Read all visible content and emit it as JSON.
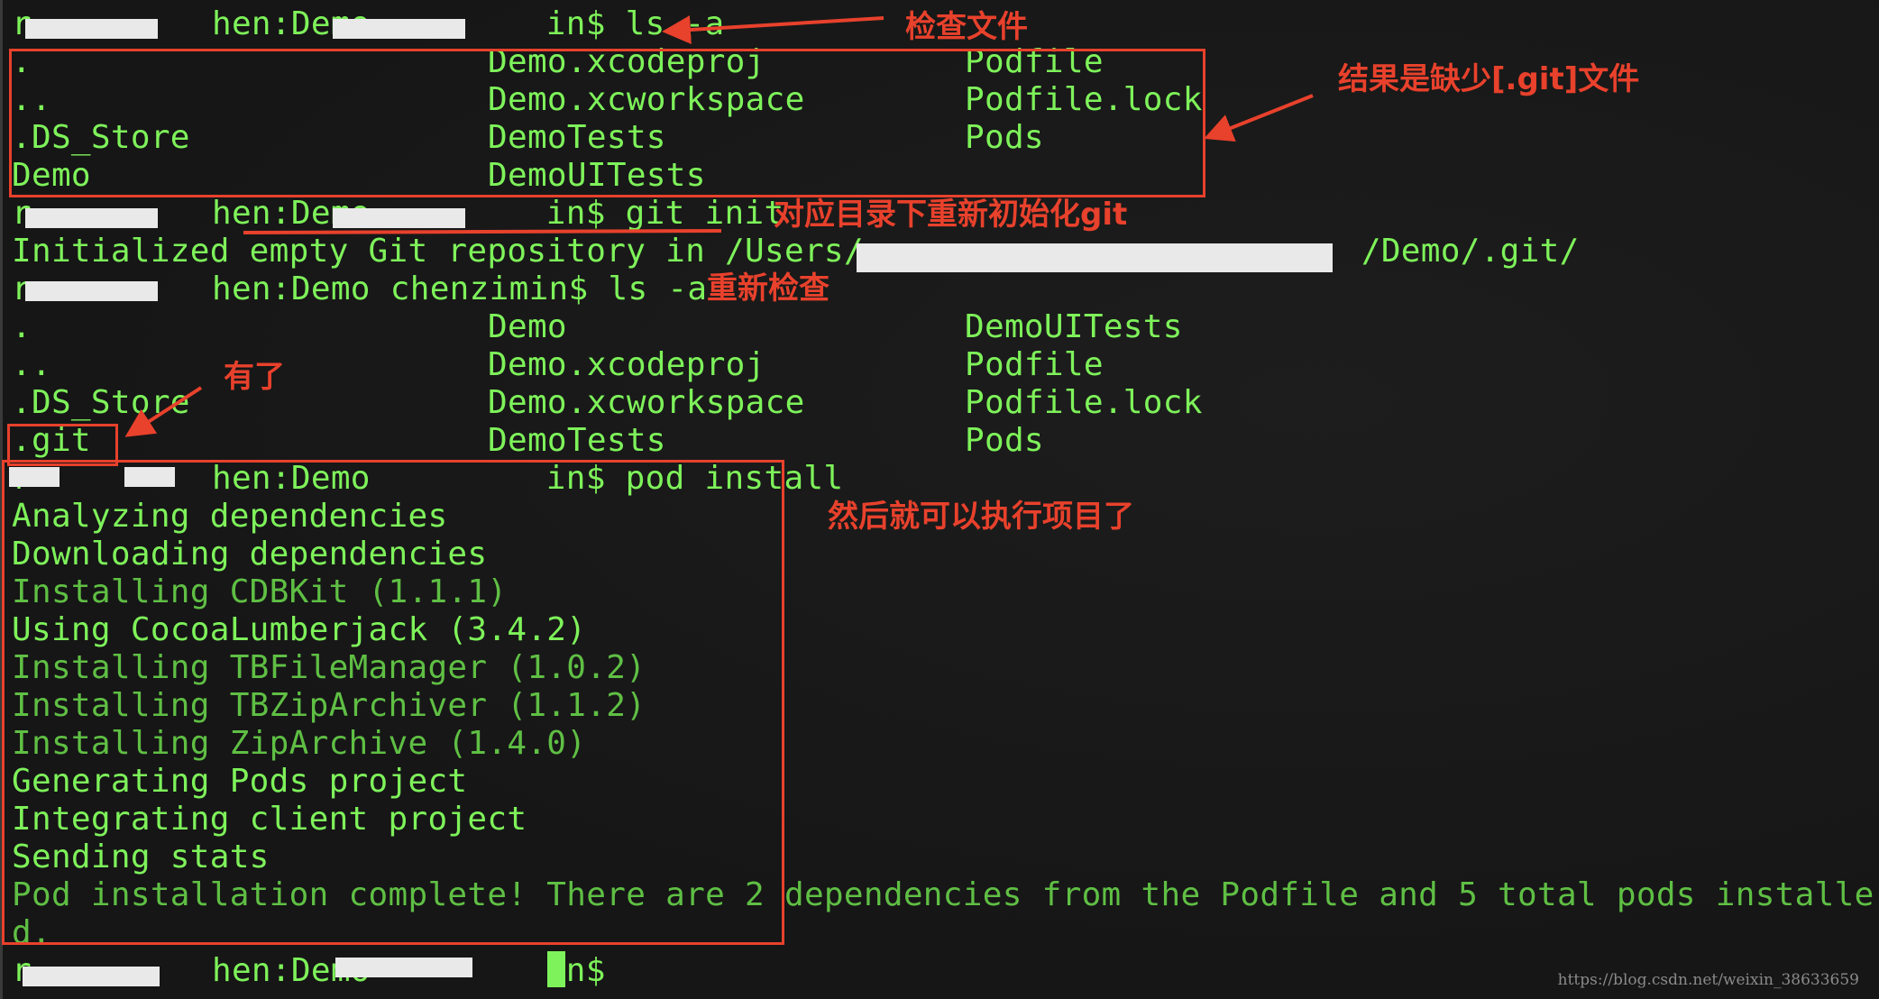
{
  "terminal": {
    "prompt_suffix": "hen:Demo ",
    "prompt_user_suffix": "in$ ",
    "full_prompt_visible": "hen:Demo chenzimin$ ",
    "lines": [
      {
        "type": "prompt",
        "command": "ls -a"
      },
      {
        "type": "ls",
        "cols": [
          ".",
          "Demo.xcodeproj",
          "Podfile"
        ]
      },
      {
        "type": "ls",
        "cols": [
          "..",
          "Demo.xcworkspace",
          "Podfile.lock"
        ]
      },
      {
        "type": "ls",
        "cols": [
          ".DS_Store",
          "DemoTests",
          "Pods"
        ]
      },
      {
        "type": "ls",
        "cols": [
          "Demo",
          "DemoUITests",
          ""
        ]
      },
      {
        "type": "prompt",
        "command": "git init"
      },
      {
        "type": "output",
        "text": "Initialized empty Git repository in /Users/",
        "suffix": " /Demo/.git/"
      },
      {
        "type": "prompt2",
        "command": "ls -a"
      },
      {
        "type": "ls",
        "cols": [
          ".",
          "Demo",
          "DemoUITests"
        ]
      },
      {
        "type": "ls",
        "cols": [
          "..",
          "Demo.xcodeproj",
          "Podfile"
        ]
      },
      {
        "type": "ls",
        "cols": [
          ".DS_Store",
          "Demo.xcworkspace",
          "Podfile.lock"
        ]
      },
      {
        "type": "ls",
        "cols": [
          ".git",
          "DemoTests",
          "Pods"
        ]
      },
      {
        "type": "prompt",
        "command": "pod install"
      },
      {
        "type": "output",
        "text": "Analyzing dependencies"
      },
      {
        "type": "output",
        "text": "Downloading dependencies"
      },
      {
        "type": "dim",
        "text": "Installing CDBKit (1.1.1)"
      },
      {
        "type": "output",
        "text": "Using CocoaLumberjack (3.4.2)"
      },
      {
        "type": "dim",
        "text": "Installing TBFileManager (1.0.2)"
      },
      {
        "type": "dim",
        "text": "Installing TBZipArchiver (1.1.2)"
      },
      {
        "type": "dim",
        "text": "Installing ZipArchive (1.4.0)"
      },
      {
        "type": "output",
        "text": "Generating Pods project"
      },
      {
        "type": "output",
        "text": "Integrating client project"
      },
      {
        "type": "output",
        "text": "Sending stats"
      },
      {
        "type": "dim",
        "text": "Pod installation complete! There are 2 dependencies from the Podfile and 5 total pods installe"
      },
      {
        "type": "dim",
        "text": "d."
      },
      {
        "type": "prompt",
        "command": ""
      }
    ]
  },
  "annotations": {
    "check_files": "检查文件",
    "missing_git": "结果是缺少[.git]文件",
    "reinit_git": "对应目录下重新初始化git",
    "recheck": "重新检查",
    "have_it": "有了",
    "then_run": "然后就可以执行项目了"
  },
  "watermark": "https://blog.csdn.net/weixin_38633659",
  "colors": {
    "text": "#7ef25a",
    "dim_text": "#5fbf44",
    "annotation": "#e8412c",
    "background": "#181818"
  }
}
